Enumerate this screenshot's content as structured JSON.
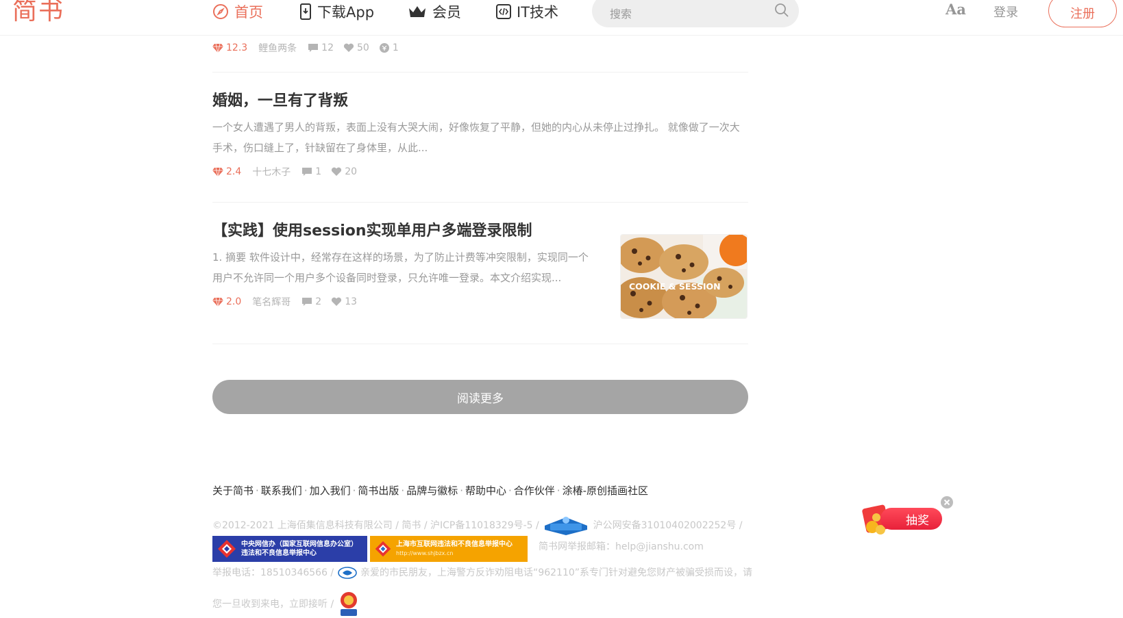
{
  "header": {
    "logo": "简书",
    "nav": {
      "home": "首页",
      "download": "下载App",
      "vip": "会员",
      "it": "IT技术"
    },
    "search_placeholder": "搜索",
    "aa": "Aa",
    "login": "登录",
    "signup": "注册"
  },
  "top_meta": {
    "diamond": "12.3",
    "author": "鲤鱼两条",
    "comments": "12",
    "likes": "50",
    "rewards": "1"
  },
  "articles": [
    {
      "title": "婚姻，一旦有了背叛",
      "abstract": "一个女人遭遇了男人的背叛，表面上没有大哭大闹，好像恢复了平静，但她的内心从未停止过挣扎。 就像做了一次大手术，伤口缝上了，针缺留在了身体里，从此...",
      "diamond": "2.4",
      "author": "十七木子",
      "comments": "1",
      "likes": "20"
    },
    {
      "title": "【实践】使用session实现单用户多端登录限制",
      "abstract": "1. 摘要 软件设计中，经常存在这样的场景，为了防止计费等冲突限制，实现同一个用户不允许同一个用户多个设备同时登录，只允许唯一登录。本文介绍实现...",
      "diamond": "2.0",
      "author": "笔名辉哥",
      "comments": "2",
      "likes": "13",
      "thumb_text": "COOKIE & SESSION"
    }
  ],
  "read_more": "阅读更多",
  "footer": {
    "links": [
      "关于简书",
      "联系我们",
      "加入我们",
      "简书出版",
      "品牌与徽标",
      "帮助中心",
      "合作伙伴",
      "涂椿-原创插画社区"
    ],
    "link_sep": "·",
    "copyright": "©2012-2021 上海佰集信息科技有限公司 / 简书 / 沪ICP备11018329号-5 /",
    "police": "沪公网安备31010402002252号 /",
    "banner1_line1": "中央网信办（国家互联网信息办公室）",
    "banner1_line2": "违法和不良信息举报中心",
    "banner2_line1": "上海市互联网违法和不良信息举报中心",
    "banner2_line2": "http://www.shjbzx.cn",
    "report_email": "简书网举报邮箱：help@jianshu.com",
    "report_phone": "举报电话：18510346566 /",
    "notice": "亲爱的市民朋友，上海警方反诈劝阻电话“962110”系专门针对避免您财产被骗受损而设，请",
    "notice2": "您一旦收到来电，立即接听 /"
  },
  "lottery": {
    "label": "抽奖"
  },
  "colors": {
    "accent": "#ea6f5a",
    "muted": "#b4b4b4",
    "button_gray": "#a5a5a5"
  }
}
